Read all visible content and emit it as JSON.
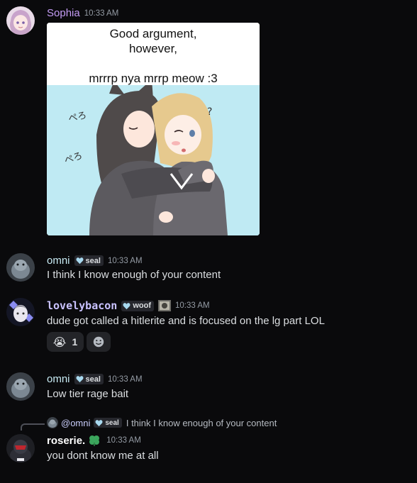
{
  "messages": [
    {
      "author": "Sophia",
      "author_color": "#c49cf5",
      "time": "10:33 AM",
      "image": {
        "caption_line1": "Good argument,",
        "caption_line2": "however,",
        "caption_line3": "mrrrp nya mrrp meow :3",
        "scribble_1": "ぺろ",
        "scribble_2": "ぺろ",
        "scribble_3": "?"
      }
    },
    {
      "author": "omni",
      "author_color": "#c9ecf5",
      "tag": "seal",
      "time": "10:33 AM",
      "text": "I think I know enough of your content"
    },
    {
      "author": "lovelybacon",
      "author_color": "#c9c2ff",
      "tag": "woof",
      "time": "10:33 AM",
      "text": "dude got called a hitlerite and is focused on the lg part LOL",
      "reactions": [
        {
          "emoji": "😭",
          "count": "1"
        },
        {
          "emoji_icon": "add-reaction-icon"
        }
      ]
    },
    {
      "author": "omni",
      "author_color": "#c9ecf5",
      "tag": "seal",
      "time": "10:33 AM",
      "text": "Low tier rage bait"
    },
    {
      "reply": {
        "mention": "@omni",
        "tag": "seal",
        "text": "I think I know enough of your content"
      },
      "author": "roserie.",
      "author_color": "#ffffff",
      "time": "10:33 AM",
      "text": "you dont know me at all"
    }
  ]
}
